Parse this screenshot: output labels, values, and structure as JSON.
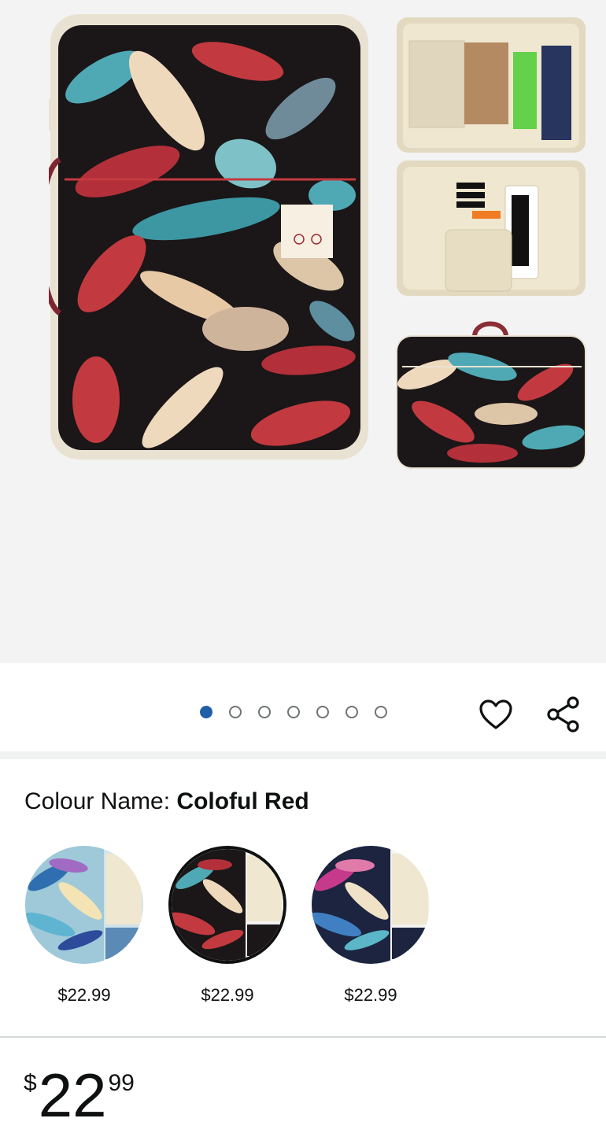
{
  "gallery": {
    "image_count": 7,
    "active_index": 0,
    "wishlist_icon": "heart-icon",
    "share_icon": "share-icon"
  },
  "variation": {
    "label": "Colour Name: ",
    "selected_value": "Coloful Red",
    "options": [
      {
        "price": "$22.99",
        "selected": false,
        "palette": "blue"
      },
      {
        "price": "$22.99",
        "selected": true,
        "palette": "red"
      },
      {
        "price": "$22.99",
        "selected": false,
        "palette": "navy"
      }
    ]
  },
  "price": {
    "symbol": "$",
    "whole": "22",
    "fraction": "99"
  },
  "colors": {
    "accent_dot": "#1f5fa8",
    "bag_black": "#1b1617",
    "leaf_red": "#c23a3f",
    "leaf_teal": "#4fa9b5",
    "leaf_cream": "#efd9bd",
    "lining_cream": "#efe7cf"
  }
}
